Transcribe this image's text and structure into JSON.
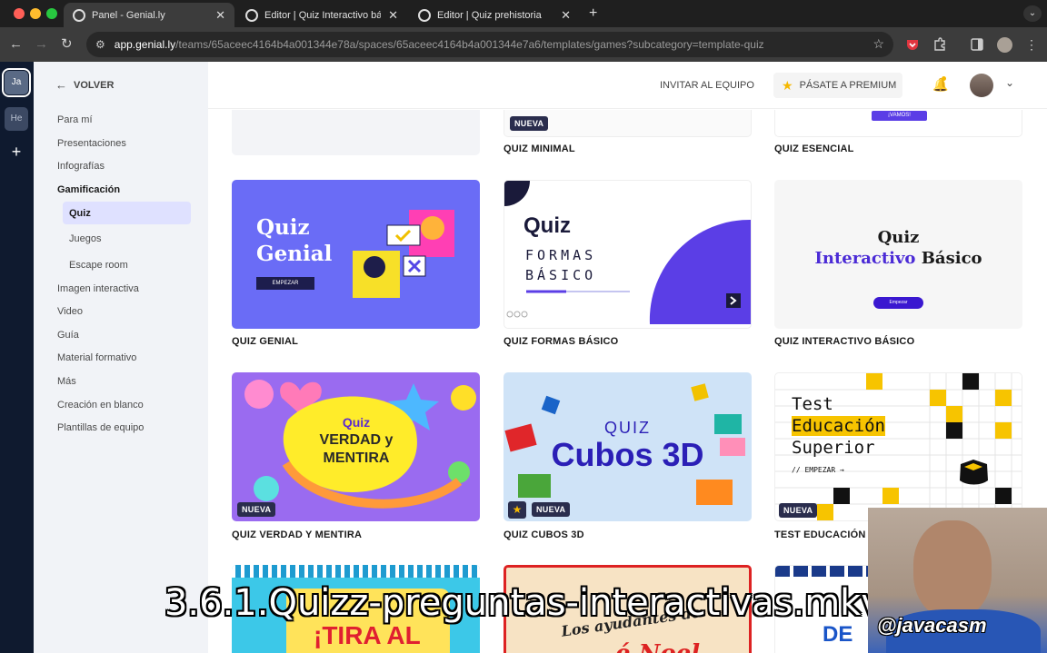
{
  "browser": {
    "tabs": [
      {
        "title": "Panel - Genial.ly"
      },
      {
        "title": "Editor | Quiz Interactivo básic"
      },
      {
        "title": "Editor | Quiz prehistoria"
      }
    ],
    "url_host": "app.genial.ly",
    "url_path": "/teams/65aceec4164b4a001344e78a/spaces/65aceec4164b4a001344e7a6/templates/games?subcategory=template-quiz"
  },
  "rail": {
    "ws1": "Ja",
    "ws2": "He",
    "add": "+"
  },
  "sidebar": {
    "back": "VOLVER",
    "items": [
      "Para mí",
      "Presentaciones",
      "Infografías",
      "Gamificación",
      "Quiz",
      "Juegos",
      "Escape room",
      "Imagen interactiva",
      "Video",
      "Guía",
      "Material formativo",
      "Más",
      "Creación en blanco",
      "Plantillas de equipo"
    ]
  },
  "header": {
    "invite": "INVITAR AL EQUIPO",
    "premium": "PÁSATE A PREMIUM"
  },
  "cards": {
    "row0": {
      "c2": "QUIZ MINIMAL",
      "c2_badge": "NUEVA",
      "c3": "QUIZ ESENCIAL",
      "c3_btn": "¡VAMOS!"
    },
    "row1": {
      "c1": "QUIZ GENIAL",
      "c1_t1": "Quiz",
      "c1_t2": "Genial",
      "c1_btn": "EMPEZAR",
      "c2": "QUIZ FORMAS BÁSICO",
      "c2_t1": "Quiz",
      "c2_t2": "FORMAS",
      "c2_t3": "BÁSICO",
      "c3": "QUIZ INTERACTIVO BÁSICO",
      "c3_t1": "Quiz",
      "c3_t2": "Interactivo",
      "c3_t3": "Básico",
      "c3_btn": "Empezar"
    },
    "row2": {
      "c1": "QUIZ VERDAD Y MENTIRA",
      "c1_t1": "Quiz",
      "c1_t2": "VERDAD y",
      "c1_t3": "MENTIRA",
      "c1_badge": "NUEVA",
      "c2": "QUIZ CUBOS 3D",
      "c2_t1": "QUIZ",
      "c2_t2": "Cubos 3D",
      "c2_badge": "NUEVA",
      "c3": "TEST EDUCACIÓN S",
      "c3_t1": "Test",
      "c3_t2": "Educación",
      "c3_t3": "Superior",
      "c3_t4": "// EMPEZAR →",
      "c3_badge": "NUEVA"
    },
    "row3": {
      "c1": "¡TIRA AL",
      "c2": "Los ayudantes de",
      "c2b": "é Noel",
      "c3": "DE"
    }
  },
  "overlay": {
    "subtitle": "3.6.1.Quizz-preguntas-interactivas.mkv",
    "watermark": "@javacasm"
  },
  "colors": {
    "accent": "#6268f5",
    "brand_dark": "#2a2d4d",
    "premium_star": "#f5b800"
  }
}
